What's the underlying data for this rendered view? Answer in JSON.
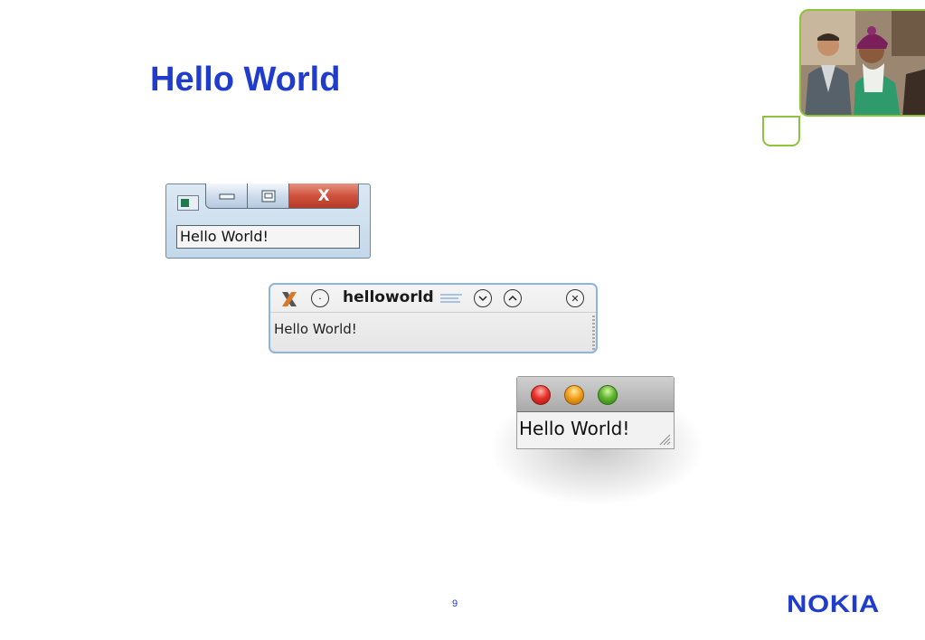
{
  "slide": {
    "title": "Hello World",
    "page_number": "9",
    "logo_text": "NOKIA"
  },
  "photo": {
    "description_icon": "people-photo"
  },
  "windows": {
    "windows_vista": {
      "app_icon": "app-icon",
      "minimize_icon": "minimize-icon",
      "maximize_icon": "maximize-icon",
      "close_label": "X",
      "content_text": "Hello World!"
    },
    "kde": {
      "title": "helloworld",
      "content_text": "Hello World!",
      "close_glyph": "✕"
    },
    "mac": {
      "content_text": "Hello World!"
    }
  },
  "colors": {
    "title_blue": "#1f3ccc",
    "accent_green": "#8cc43e",
    "vista_close_red": "#d0523e"
  }
}
